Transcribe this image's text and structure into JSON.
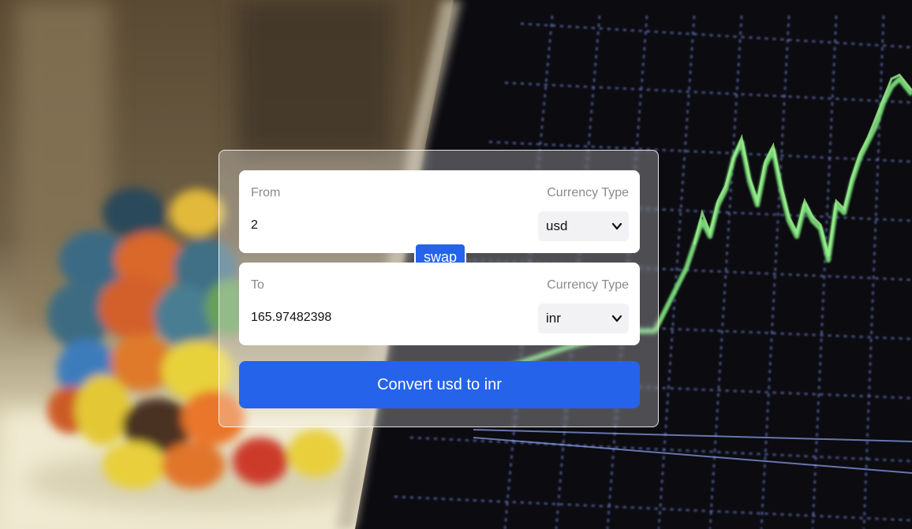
{
  "from": {
    "label": "From",
    "currency_label": "Currency Type",
    "amount": "2",
    "currency": "usd"
  },
  "to": {
    "label": "To",
    "currency_label": "Currency Type",
    "amount": "165.97482398",
    "currency": "inr"
  },
  "swap_label": "swap",
  "convert_label": "Convert usd to inr",
  "colors": {
    "accent": "#2563eb",
    "card_border": "#ffffff",
    "label": "#8a8a8a"
  },
  "icons": {
    "dropdown": "chevron-down-icon"
  }
}
